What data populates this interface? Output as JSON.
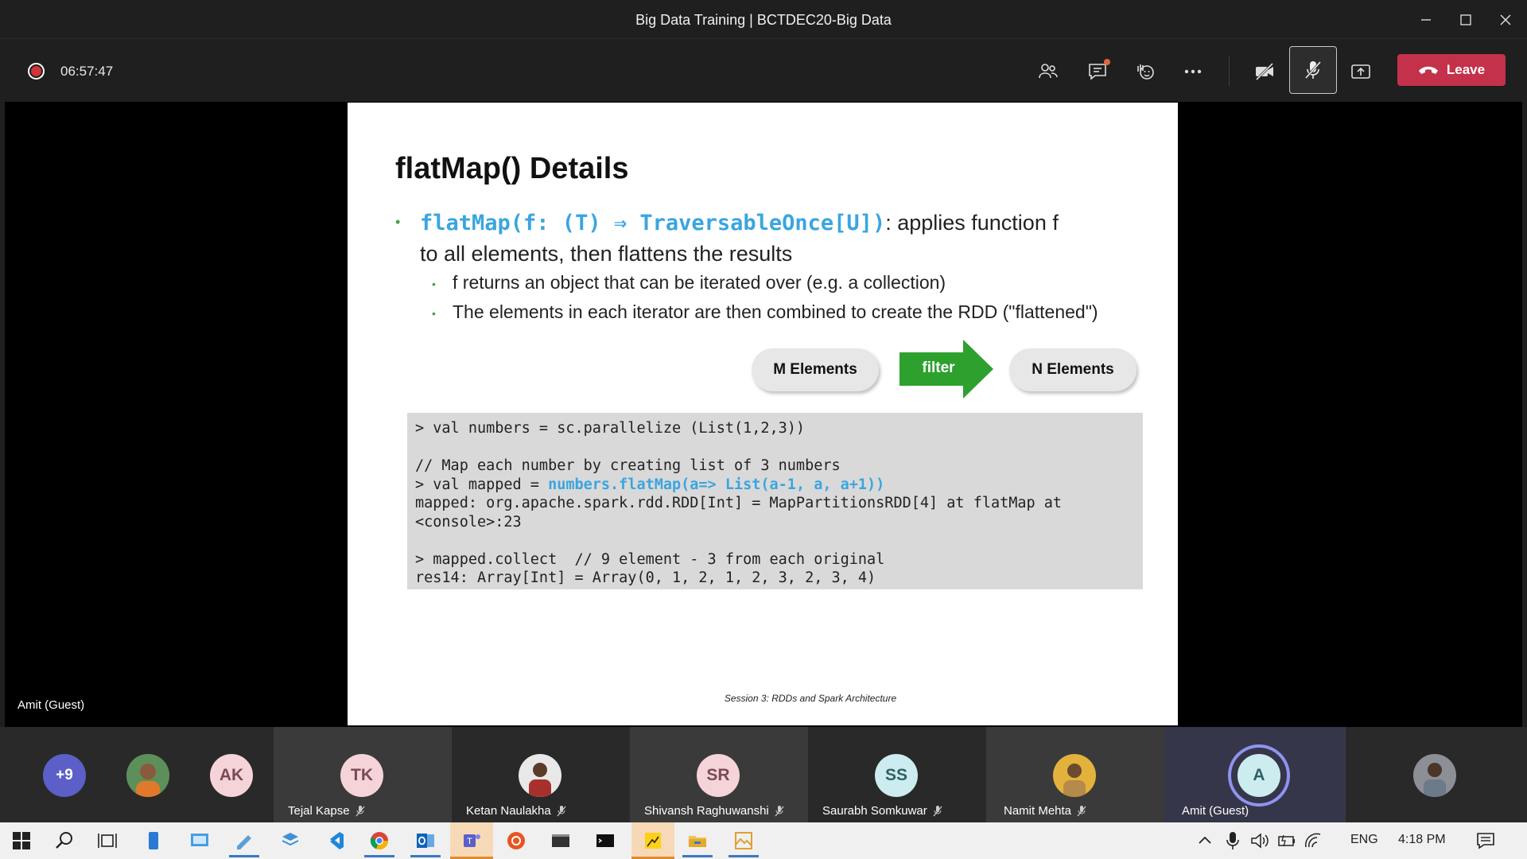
{
  "window": {
    "title": "Big Data Training | BCTDEC20-Big Data"
  },
  "controls": {
    "timer": "06:57:47",
    "leave_label": "Leave"
  },
  "stage": {
    "presenter_label": "Amit (Guest)"
  },
  "slide": {
    "title": "flatMap() Details",
    "bullet_code": "flatMap(f: (T) ⇒ TraversableOnce[U])",
    "bullet_text_1": ": applies function f",
    "bullet_text_2": "to all elements, then flattens the results",
    "sub_bullets": [
      "f returns an object that can be iterated over (e.g. a collection)",
      "The elements in each iterator are then combined to create the RDD (\"flattened\")"
    ],
    "diagram": {
      "left": "M Elements",
      "arrow": "filter",
      "right": "N Elements"
    },
    "code_lines": [
      "> val numbers = sc.parallelize (List(1,2,3))",
      "",
      "// Map each number by creating list of 3 numbers",
      "> val mapped = ",
      "numbers.flatMap(a=> List(a-1, a, a+1))",
      "mapped: org.apache.spark.rdd.RDD[Int] = MapPartitionsRDD[4] at flatMap at",
      "<console>:23",
      "",
      "> mapped.collect  // 9 element - 3 from each original",
      "res14: Array[Int] = Array(0, 1, 2, 1, 2, 3, 2, 3, 4)"
    ],
    "footer": "Session 3: RDDs and Spark Architecture"
  },
  "participants": {
    "overflow_label": "+9",
    "items": [
      {
        "initials": "",
        "name": ""
      },
      {
        "initials": "AK",
        "name": ""
      },
      {
        "initials": "TK",
        "name": "Tejal Kapse"
      },
      {
        "initials": "",
        "name": "Ketan Naulakha"
      },
      {
        "initials": "SR",
        "name": "Shivansh Raghuwanshi"
      },
      {
        "initials": "SS",
        "name": "Saurabh Somkuwar"
      },
      {
        "initials": "",
        "name": "Namit Mehta"
      },
      {
        "initials": "A",
        "name": "Amit (Guest)"
      },
      {
        "initials": "",
        "name": ""
      }
    ]
  },
  "taskbar": {
    "language": "ENG",
    "time": "4:18 PM"
  },
  "colors": {
    "leave": "#c4314b",
    "record": "#d13438",
    "accent_purple": "#5b5fc7",
    "code_highlight": "#3aa5e0",
    "arrow_green": "#2ea02e"
  }
}
